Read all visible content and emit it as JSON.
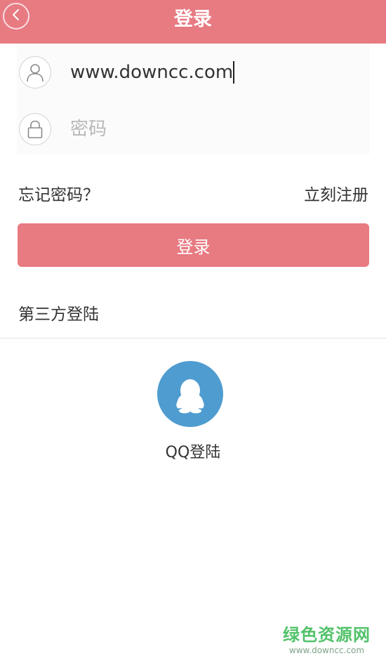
{
  "header": {
    "title": "登录",
    "back_icon": "chevron-left-icon"
  },
  "form": {
    "username_icon": "user-icon",
    "username_value": "www.downcc.com",
    "password_icon": "lock-icon",
    "password_placeholder": "密码",
    "password_value": ""
  },
  "links": {
    "forgot": "忘记密码？",
    "register": "立刻注册"
  },
  "login_button": "登录",
  "third_party": {
    "title": "第三方登陆",
    "qq_icon": "qq-penguin-icon",
    "qq_label": "QQ登陆"
  },
  "watermark": {
    "main": "绿色资源网",
    "url": "www.downcc.com"
  },
  "colors": {
    "accent": "#e87a82",
    "qq_blue": "#4f9cd0",
    "watermark_green": "#52c26a"
  }
}
